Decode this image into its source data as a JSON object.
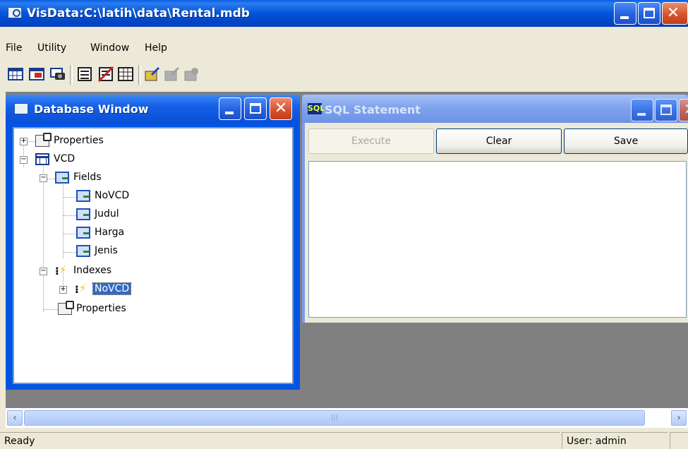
{
  "app": {
    "title": "VisData:C:\\latih\\data\\Rental.mdb"
  },
  "menu": [
    "File",
    "Utility",
    "Window",
    "Help"
  ],
  "toolbar": {
    "icons": [
      "table-type-icon",
      "dynaset-type-icon",
      "snapshot-type-icon",
      "data-control-icon",
      "no-data-control-icon",
      "grid-icon",
      "begin-transaction-icon",
      "commit-icon",
      "rollback-icon"
    ]
  },
  "db_window": {
    "title": "Database Window",
    "tree": {
      "properties_root": "Properties",
      "table": "VCD",
      "fields_group": "Fields",
      "fields": [
        "NoVCD",
        "Judul",
        "Harga",
        "Jenis"
      ],
      "indexes_group": "Indexes",
      "index_item": "NoVCD",
      "table_properties": "Properties"
    }
  },
  "sql_window": {
    "title": "SQL Statement",
    "execute": "Execute",
    "clear": "Clear",
    "save": "Save"
  },
  "status": {
    "left": "Ready",
    "user": "User: admin"
  },
  "colors": {
    "titlebar": "#0454d9",
    "selection": "#316ac5",
    "mdi_background": "#808080"
  }
}
